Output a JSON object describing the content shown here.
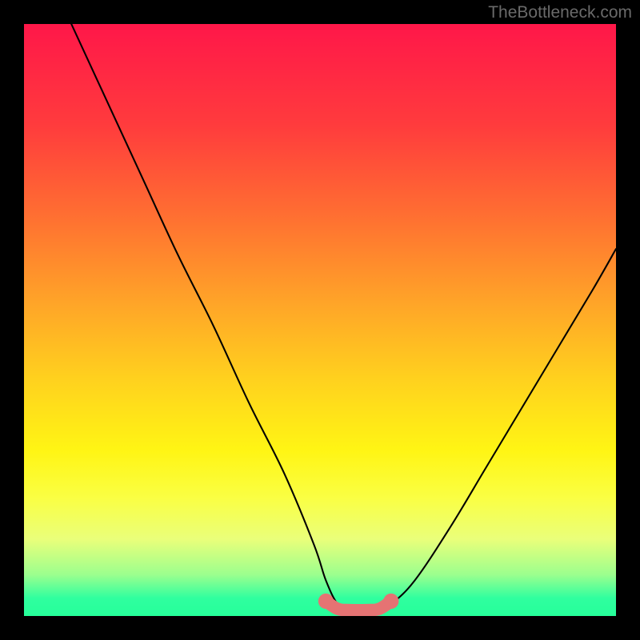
{
  "watermark": "TheBottleneck.com",
  "chart_data": {
    "type": "line",
    "title": "",
    "xlabel": "",
    "ylabel": "",
    "xlim": [
      0,
      100
    ],
    "ylim": [
      0,
      100
    ],
    "grid": false,
    "legend": false,
    "annotations": [],
    "series": [
      {
        "name": "bottleneck-curve",
        "x": [
          8,
          14,
          20,
          26,
          32,
          38,
          44,
          49,
          51,
          53,
          55,
          58,
          60,
          62,
          66,
          72,
          78,
          84,
          90,
          96,
          100
        ],
        "values": [
          100,
          87,
          74,
          61,
          49,
          36,
          24,
          12,
          6,
          2,
          1,
          1,
          1,
          2,
          6,
          15,
          25,
          35,
          45,
          55,
          62
        ]
      }
    ],
    "highlight": {
      "name": "bottom-band",
      "color": "#e57373",
      "x": [
        51,
        53,
        55,
        58,
        60,
        62
      ],
      "values": [
        2.5,
        1.2,
        1.0,
        1.0,
        1.2,
        2.5
      ]
    },
    "background_gradient": {
      "stops": [
        {
          "pct": 0,
          "color": "#ff1749"
        },
        {
          "pct": 17,
          "color": "#ff3b3d"
        },
        {
          "pct": 33,
          "color": "#ff7131"
        },
        {
          "pct": 47,
          "color": "#ffa428"
        },
        {
          "pct": 60,
          "color": "#ffd11e"
        },
        {
          "pct": 72,
          "color": "#fff514"
        },
        {
          "pct": 80,
          "color": "#faff43"
        },
        {
          "pct": 87,
          "color": "#eaff7a"
        },
        {
          "pct": 93,
          "color": "#9cff8e"
        },
        {
          "pct": 97,
          "color": "#2fff9f"
        },
        {
          "pct": 100,
          "color": "#26ff9a"
        }
      ]
    }
  }
}
